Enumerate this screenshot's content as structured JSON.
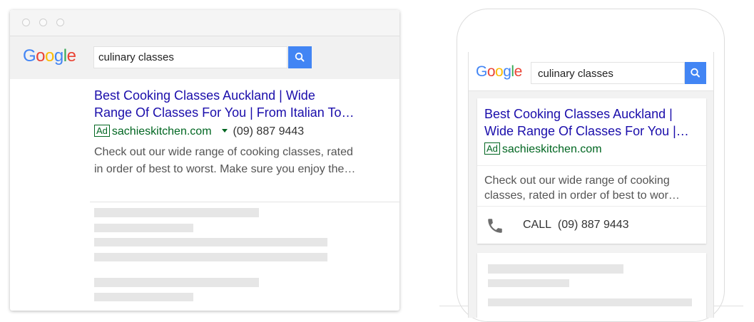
{
  "colors": {
    "link": "#1a0dab",
    "url_green": "#006621",
    "search_button": "#4285f4",
    "skeleton": "#e6e6e6"
  },
  "logo": {
    "letters": [
      {
        "char": "G",
        "color": "#4285f4"
      },
      {
        "char": "o",
        "color": "#ea4335"
      },
      {
        "char": "o",
        "color": "#fbbc05"
      },
      {
        "char": "g",
        "color": "#4285f4"
      },
      {
        "char": "l",
        "color": "#34a853"
      },
      {
        "char": "e",
        "color": "#ea4335"
      }
    ]
  },
  "desktop": {
    "search_query": "culinary classes",
    "search_button_icon": "search-icon",
    "ad": {
      "title_line1": "Best Cooking Classes Auckland | Wide",
      "title_line2": "Range Of Classes For You | From Italian To…",
      "badge": "Ad",
      "display_url": "sachieskitchen.com",
      "phone": "(09) 887 9443",
      "desc_line1": "Check out our wide range of cooking classes, rated",
      "desc_line2": "in order of best to worst. Make sure you enjoy the…"
    }
  },
  "mobile": {
    "search_query": "culinary classes",
    "search_button_icon": "search-icon",
    "ad": {
      "title_line1": "Best Cooking Classes Auckland |",
      "title_line2": "Wide Range Of Classes For You |…",
      "badge": "Ad",
      "display_url": "sachieskitchen.com",
      "desc_line1": "Check out our wide range of cooking",
      "desc_line2": "classes, rated in order of best to wor…",
      "call_label": "CALL",
      "call_icon": "phone-icon",
      "phone": "(09) 887 9443"
    }
  }
}
